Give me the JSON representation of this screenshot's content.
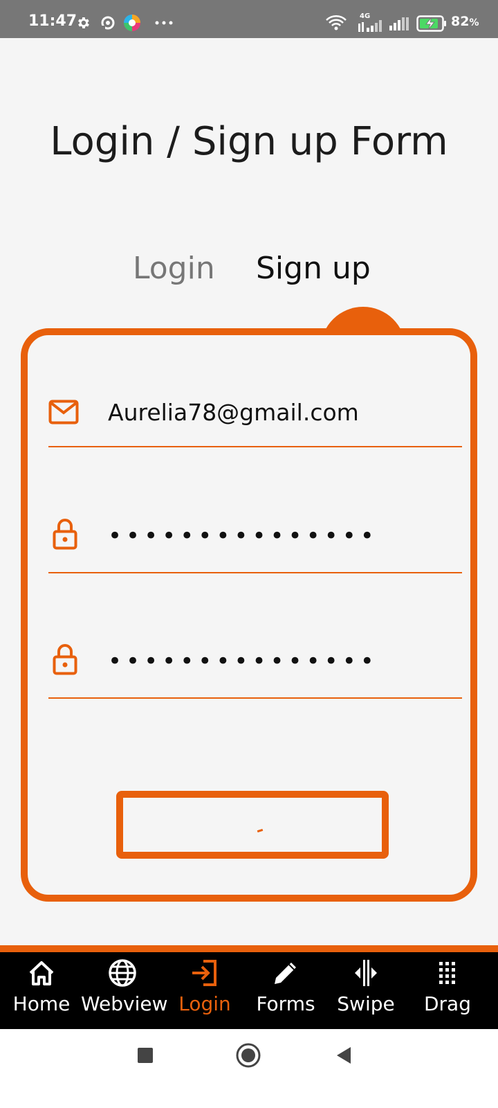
{
  "status_bar": {
    "time": "11:47",
    "battery": "82",
    "battery_unit": "%",
    "network_label": "4G",
    "icons": [
      "gear-icon",
      "sync-icon",
      "browser-icon",
      "more-icon",
      "wifi-icon",
      "signal-4g-icon",
      "signal-icon",
      "battery-charging-icon"
    ]
  },
  "page": {
    "title": "Login / Sign up Form"
  },
  "tabs": {
    "login": "Login",
    "signup": "Sign up",
    "active": "signup"
  },
  "form": {
    "email_value": "Aurelia78@gmail.com",
    "password_value": "•••••••••••••••",
    "confirm_value": "•••••••••••••••",
    "email_icon": "mail-icon",
    "password_icon": "lock-icon",
    "submit_label": ""
  },
  "bottom_nav": {
    "items": [
      {
        "label": "Home",
        "icon": "home-icon"
      },
      {
        "label": "Webview",
        "icon": "globe-icon"
      },
      {
        "label": "Login",
        "icon": "login-icon"
      },
      {
        "label": "Forms",
        "icon": "pencil-icon"
      },
      {
        "label": "Swipe",
        "icon": "swipe-icon"
      },
      {
        "label": "Drag",
        "icon": "grid-icon"
      }
    ],
    "active": "Login"
  },
  "system_nav": {
    "icons": [
      "recents-icon",
      "home-circle-icon",
      "back-icon"
    ]
  },
  "colors": {
    "accent": "#e8600c",
    "status_bar": "#777777",
    "background": "#f5f5f5",
    "tabbar": "#000000"
  }
}
